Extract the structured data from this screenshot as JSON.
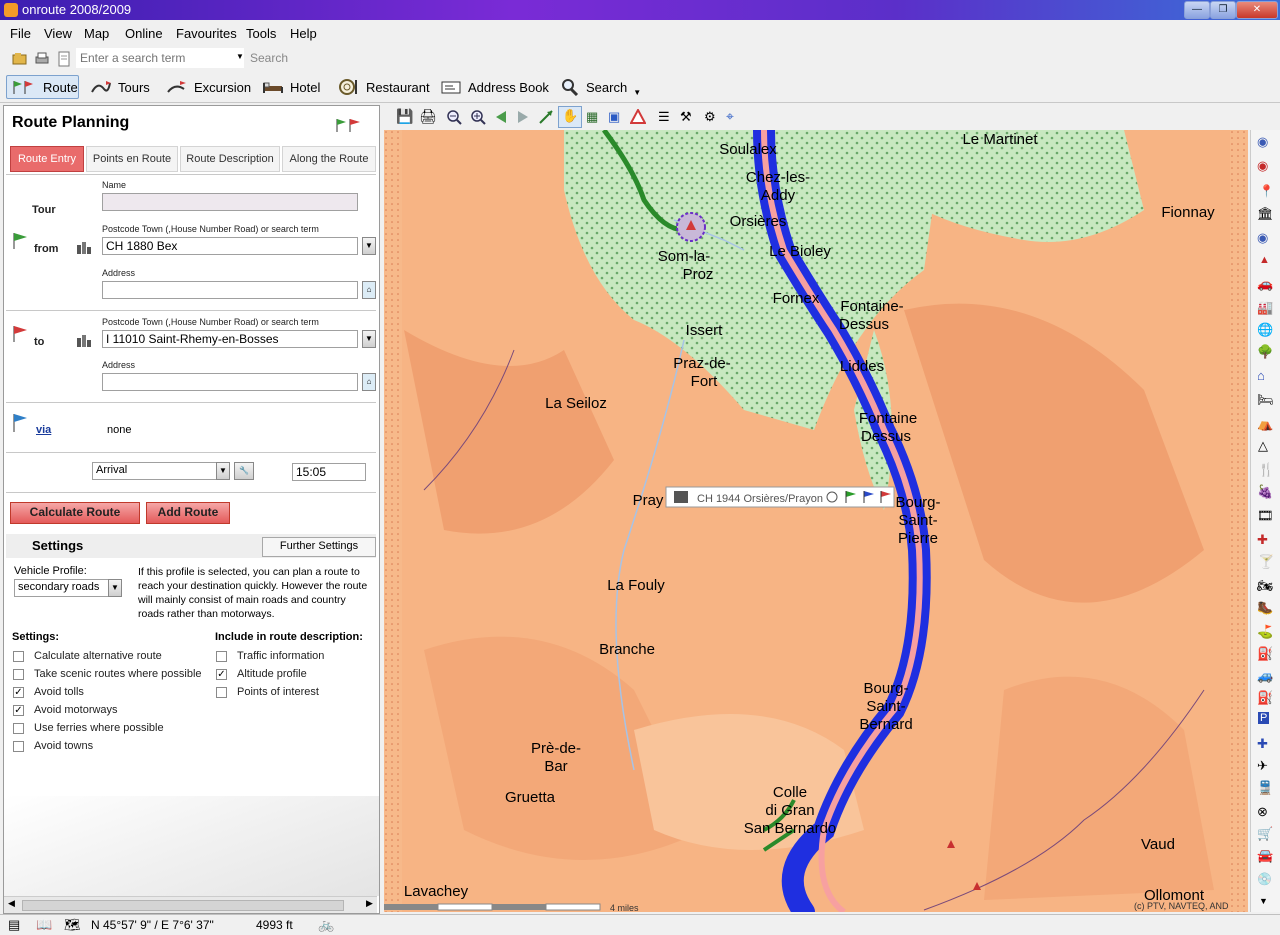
{
  "window": {
    "title": "onroute 2008/2009",
    "min": "—",
    "max": "❐",
    "close": "✕"
  },
  "menu": [
    "File",
    "View",
    "Map",
    "Online",
    "Favourites",
    "Tools",
    "Help"
  ],
  "search": {
    "placeholder": "Enter a search term",
    "button": "Search"
  },
  "toolbar": {
    "route": "Route",
    "tours": "Tours",
    "excursion": "Excursion",
    "hotel": "Hotel",
    "restaurant": "Restaurant",
    "address_book": "Address Book",
    "search": "Search"
  },
  "panel": {
    "title": "Route Planning",
    "tabs": [
      "Route Entry",
      "Points en Route",
      "Route Description",
      "Along the Route"
    ],
    "tour_label": "Tour",
    "name_label": "Name",
    "name_value": "",
    "from_label": "from",
    "from_field_label": "Postcode Town (,House Number Road) or search term",
    "from_value": "CH 1880 Bex",
    "address_label": "Address",
    "from_address": "",
    "to_label": "to",
    "to_field_label": "Postcode Town (,House Number Road) or search term",
    "to_value": "I 11010 Saint-Rhemy-en-Bosses",
    "to_address": "",
    "via_label": "via",
    "via_value": "none",
    "time_mode": "Arrival",
    "time_value": "15:05",
    "calc_button": "Calculate Route",
    "add_button": "Add Route",
    "settings_title": "Settings",
    "further_settings": "Further Settings",
    "vehicle_profile_label": "Vehicle Profile:",
    "vehicle_profile": "secondary roads",
    "profile_desc": "If this profile is selected, you can plan a route to reach your destination quickly. However the route will mainly consist of main roads and country roads rather than motorways.",
    "settings_label": "Settings:",
    "include_label": "Include in route description:",
    "settings_items": [
      {
        "label": "Calculate alternative route",
        "checked": false
      },
      {
        "label": "Take scenic routes where possible",
        "checked": false
      },
      {
        "label": "Avoid tolls",
        "checked": true
      },
      {
        "label": "Avoid motorways",
        "checked": true
      },
      {
        "label": "Use ferries where possible",
        "checked": false
      },
      {
        "label": "Avoid towns",
        "checked": false
      }
    ],
    "include_items": [
      {
        "label": "Traffic information",
        "checked": false
      },
      {
        "label": "Altitude profile",
        "checked": true
      },
      {
        "label": "Points of interest",
        "checked": false
      }
    ]
  },
  "map": {
    "tooltip": "CH 1944 Orsières/Prayon",
    "places": [
      "Soulalex",
      "Chez-les-",
      "Addy",
      "Orsières",
      "Le Martinet",
      "Fionnay",
      "Le Bioley",
      "Som-la-",
      "Proz",
      "Fornex",
      "Fontaine-",
      "Dessus",
      "Issert",
      "Praz-de-",
      "Fort",
      "Liddes",
      "La Seiloz",
      "Fontaine",
      "Dessus",
      "Pray",
      "Bourg-",
      "Saint-",
      "Pierre",
      "La Fouly",
      "Branche",
      "Bourg-",
      "Saint-",
      "Bernard",
      "Prè-de-",
      "Bar",
      "Gruetta",
      "Colle",
      "di Gran",
      "San Bernardo",
      "Vaud",
      "Lavachey",
      "Ollomont"
    ],
    "scale": "4 miles",
    "copyright": "(c) PTV, NAVTEQ, AND"
  },
  "status": {
    "coords": "N 45°57' 9\" / E 7°6' 37\"",
    "altitude": "4993 ft"
  }
}
